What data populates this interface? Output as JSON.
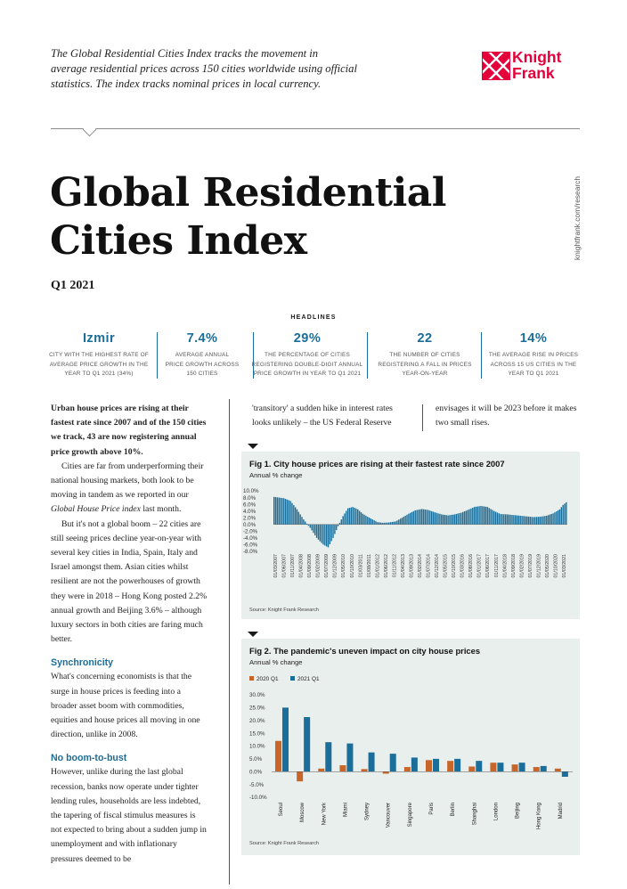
{
  "intro": {
    "line1": "The Global Residential Cities Index tracks the movement in",
    "line2": "average residential prices across 150 cities worldwide using official",
    "line3": "statistics. The index tracks nominal prices in local currency."
  },
  "logo": {
    "line1": "Knight",
    "line2": "Frank"
  },
  "title": {
    "line1": "Global Residential",
    "line2": "Cities Index"
  },
  "subtitle": "Q1 2021",
  "side_url": "knightfrank.com/research",
  "headlines": {
    "heading": "HEADLINES",
    "items": [
      {
        "value": "Izmir",
        "l1": "City with the highest rate of",
        "l2": "average price growth in the",
        "l3": "year to Q1 2021 (34%)"
      },
      {
        "value": "7.4%",
        "l1": "Average annual",
        "l2": "price growth across",
        "l3": "150 cities"
      },
      {
        "value": "29%",
        "l1": "The percentage of cities",
        "l2": "registering double-digit annual",
        "l3": "price growth in year to Q1 2021"
      },
      {
        "value": "22",
        "l1": "The number of cities",
        "l2": "registering a fall in prices",
        "l3": "year-on-year"
      },
      {
        "value": "14%",
        "l1": "The average rise in prices",
        "l2": "across 15 US cities in the",
        "l3": "year to Q1 2021"
      }
    ]
  },
  "body": {
    "lead": "Urban house prices are rising at their fastest rate since 2007 and of the 150 cities we track, 43 are now registering annual price growth above 10%.",
    "p1a": "Cities are far from underperforming their national housing markets, both look to be moving in tandem as we reported in our ",
    "p1_em": "Global House Price index",
    "p1b": " last month.",
    "p2": "But it's not a global boom – 22 cities are still seeing prices decline year-on-year with several key cities  in India, Spain, Italy and Israel amongst them. Asian cities whilst resilient are not the powerhouses of growth they were in 2018 – Hong Kong posted 2.2% annual growth and Beijing 3.6% – although luxury sectors in both cities are faring much better.",
    "h1": "Synchronicity",
    "p3": "What's concerning economists is that the surge in house prices is feeding into a broader asset boom with commodities, equities and house prices all moving in one direction, unlike in 2008.",
    "h2": "No boom-to-bust",
    "p4": "However, unlike during the last global recession, banks now operate under tighter lending rules, households are less indebted, the tapering of fiscal stimulus measures is not expected to bring about a sudden jump in unemployment and with inflationary pressures deemed to be",
    "colA": "'transitory' a sudden hike in interest rates looks unlikely – the US Federal Reserve",
    "colB": "envisages it will be 2023 before it makes two small rises."
  },
  "fig1": {
    "title": "Fig 1. City house prices are rising at their fastest rate since 2007",
    "subtitle": "Annual % change",
    "source": "Source: Knight Frank Research"
  },
  "fig2": {
    "title": "Fig 2. The pandemic's uneven impact on city house prices",
    "subtitle": "Annual % change",
    "source": "Source: Knight Frank Research"
  },
  "colors": {
    "blue": "#1b6e9a",
    "orange": "#c8662a",
    "brand": "#e4003b",
    "panel": "#e9efed"
  },
  "chart_data": [
    {
      "type": "bar",
      "ylim": [
        -8,
        10
      ],
      "yticks": [
        "10.0%",
        "8.0%",
        "6.0%",
        "4.0%",
        "2.0%",
        "0.0%",
        "-2.0%",
        "-4.0%",
        "-6.0%",
        "-8.0%"
      ],
      "xticks": [
        "01/03/2007",
        "01/06/2007",
        "01/11/2007",
        "01/04/2008",
        "01/09/2008",
        "01/02/2009",
        "01/07/2009",
        "01/12/2009",
        "01/05/2010",
        "01/10/2010",
        "01/03/2011",
        "01/08/2011",
        "01/01/2012",
        "01/06/2012",
        "01/11/2012",
        "01/04/2013",
        "01/09/2013",
        "01/02/2014",
        "01/07/2014",
        "01/12/2014",
        "01/05/2015",
        "01/10/2015",
        "01/03/2016",
        "01/08/2016",
        "01/01/2017",
        "01/06/2017",
        "01/11/2017",
        "01/04/2018",
        "01/09/2018",
        "01/02/2019",
        "01/07/2019",
        "01/12/2019",
        "01/05/2020",
        "01/10/2020",
        "01/03/2021"
      ],
      "anchors": [
        [
          0,
          8.2
        ],
        [
          6,
          7.8
        ],
        [
          10,
          7.0
        ],
        [
          14,
          4.5
        ],
        [
          18,
          1.5
        ],
        [
          22,
          -1.0
        ],
        [
          26,
          -4.0
        ],
        [
          30,
          -6.0
        ],
        [
          33,
          -6.8
        ],
        [
          36,
          -4.0
        ],
        [
          39,
          -0.5
        ],
        [
          42,
          2.5
        ],
        [
          45,
          4.8
        ],
        [
          48,
          5.2
        ],
        [
          51,
          4.5
        ],
        [
          54,
          3.2
        ],
        [
          57,
          2.3
        ],
        [
          60,
          1.5
        ],
        [
          63,
          0.7
        ],
        [
          66,
          0.5
        ],
        [
          70,
          0.6
        ],
        [
          74,
          0.9
        ],
        [
          78,
          2.0
        ],
        [
          82,
          3.2
        ],
        [
          86,
          4.2
        ],
        [
          90,
          4.6
        ],
        [
          94,
          4.3
        ],
        [
          98,
          3.6
        ],
        [
          102,
          3.0
        ],
        [
          106,
          2.7
        ],
        [
          110,
          3.0
        ],
        [
          114,
          3.5
        ],
        [
          118,
          4.3
        ],
        [
          122,
          5.2
        ],
        [
          126,
          5.5
        ],
        [
          130,
          5.2
        ],
        [
          134,
          4.0
        ],
        [
          138,
          3.1
        ],
        [
          142,
          3.0
        ],
        [
          146,
          2.8
        ],
        [
          150,
          2.6
        ],
        [
          154,
          2.4
        ],
        [
          158,
          2.2
        ],
        [
          162,
          2.3
        ],
        [
          166,
          2.6
        ],
        [
          170,
          3.3
        ],
        [
          174,
          4.5
        ],
        [
          176,
          5.8
        ],
        [
          178,
          6.6
        ]
      ],
      "bar_count": 179
    },
    {
      "type": "bar",
      "categories": [
        "Seoul",
        "Moscow",
        "New York",
        "Miami",
        "Sydney",
        "Vancouver",
        "Singapore",
        "Paris",
        "Berlin",
        "Shanghai",
        "London",
        "Beijing",
        "Hong Kong",
        "Madrid"
      ],
      "series": [
        {
          "name": "2020 Q1",
          "color": "#c8662a",
          "values": [
            12.0,
            -3.8,
            1.2,
            2.5,
            1.0,
            -0.8,
            1.8,
            4.5,
            4.2,
            2.0,
            3.5,
            2.8,
            1.8,
            1.2
          ]
        },
        {
          "name": "2021 Q1",
          "color": "#1b6e9a",
          "values": [
            25.0,
            21.3,
            11.5,
            11.0,
            7.5,
            7.0,
            5.5,
            5.0,
            5.0,
            4.2,
            3.5,
            3.5,
            2.2,
            -2.0
          ]
        }
      ],
      "ylim": [
        -10,
        30
      ],
      "yticks": [
        "30.0%",
        "25.0%",
        "20.0%",
        "15.0%",
        "10.0%",
        "5.0%",
        "0.0%",
        "-5.0%",
        "-10.0%"
      ]
    }
  ]
}
